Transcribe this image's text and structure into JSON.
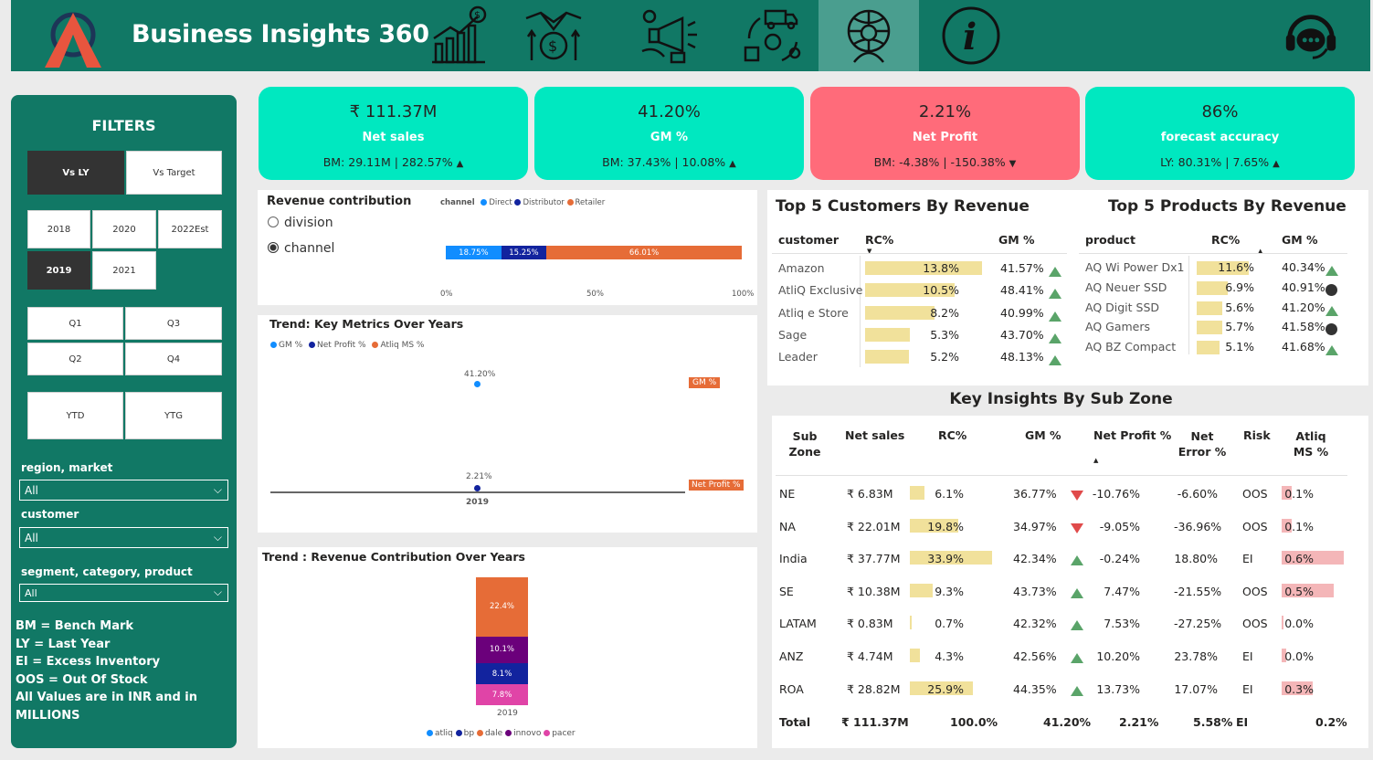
{
  "header": {
    "title": "Business Insights 360",
    "nav": [
      "finance-view-icon",
      "sales-view-icon",
      "marketing-view-icon",
      "supply-chain-view-icon",
      "executive-view-icon",
      "info-icon"
    ]
  },
  "filters": {
    "title": "FILTERS",
    "compare": [
      "Vs LY",
      "Vs Target"
    ],
    "years": [
      "2018",
      "2020",
      "2022Est",
      "2019",
      "2021"
    ],
    "quarters": [
      "Q1",
      "Q3",
      "Q2",
      "Q4"
    ],
    "ytd": [
      "YTD",
      "YTG"
    ],
    "region_label": "region, market",
    "region_value": "All",
    "customer_label": "customer",
    "customer_value": "All",
    "segment_label": "segment, category, product",
    "segment_value": "All",
    "notes": [
      "BM = Bench Mark",
      "LY = Last Year",
      "EI = Excess Inventory",
      "OOS = Out Of Stock",
      "All Values are in INR and in",
      "MILLIONS"
    ]
  },
  "kpis": [
    {
      "value": "₹ 111.37M",
      "label": "Net sales",
      "bm": "BM: 29.11M | 282.57%",
      "dir": "▲"
    },
    {
      "value": "41.20%",
      "label": "GM %",
      "bm": "BM: 37.43% | 10.08%",
      "dir": "▲"
    },
    {
      "value": "2.21%",
      "label": "Net Profit",
      "bm": "BM: -4.38% | -150.38%",
      "dir": "▼"
    },
    {
      "value": "86%",
      "label": "forecast accuracy",
      "bm": "LY: 80.31% | 7.65%",
      "dir": "▲"
    }
  ],
  "revenue_contribution": {
    "title": "Revenue contribution",
    "options": [
      "division",
      "channel"
    ],
    "selected": "channel",
    "legend_title": "channel",
    "legend": [
      "Direct",
      "Distributor",
      "Retailer"
    ],
    "colors": [
      "#118dff",
      "#12239e",
      "#e66c37"
    ],
    "values": [
      18.75,
      15.25,
      66.01
    ],
    "value_labels": [
      "18.75%",
      "15.25%",
      "66.01%"
    ],
    "axis": [
      "0%",
      "50%",
      "100%"
    ]
  },
  "trend_metrics": {
    "title": "Trend: Key Metrics Over Years",
    "legend": [
      "GM %",
      "Net Profit %",
      "Atliq MS %"
    ],
    "colors": [
      "#118dff",
      "#12239e",
      "#e66c37"
    ],
    "year": "2019",
    "gm_label": "41.20%",
    "np_label": "2.21%",
    "tag_gm": "GM %",
    "tag_np": "Net Profit %"
  },
  "trend_revenue": {
    "title": "Trend : Revenue Contribution Over Years",
    "year": "2019",
    "legend": [
      "atliq",
      "bp",
      "dale",
      "innovo",
      "pacer"
    ],
    "colors": [
      "#118dff",
      "#12239e",
      "#e66c37",
      "#6b007b",
      "#e044a7"
    ],
    "segments": [
      {
        "label": "22.4%",
        "value": 22.4,
        "color": "#e66c37"
      },
      {
        "label": "10.1%",
        "value": 10.1,
        "color": "#6b007b"
      },
      {
        "label": "8.1%",
        "value": 8.1,
        "color": "#12239e"
      },
      {
        "label": "7.8%",
        "value": 7.8,
        "color": "#e044a7"
      }
    ]
  },
  "top_customers": {
    "title": "Top 5 Customers By Revenue",
    "headers": [
      "customer",
      "RC%",
      "GM %"
    ],
    "rows": [
      {
        "name": "Amazon",
        "rc": "13.8%",
        "rc_val": 13.8,
        "gm": "41.57%",
        "icon": "up"
      },
      {
        "name": "AtliQ Exclusive",
        "rc": "10.5%",
        "rc_val": 10.5,
        "gm": "48.41%",
        "icon": "up"
      },
      {
        "name": "Atliq e Store",
        "rc": "8.2%",
        "rc_val": 8.2,
        "gm": "40.99%",
        "icon": "up"
      },
      {
        "name": "Sage",
        "rc": "5.3%",
        "rc_val": 5.3,
        "gm": "43.70%",
        "icon": "up"
      },
      {
        "name": "Leader",
        "rc": "5.2%",
        "rc_val": 5.2,
        "gm": "48.13%",
        "icon": "up"
      }
    ]
  },
  "top_products": {
    "title": "Top 5 Products By Revenue",
    "headers": [
      "product",
      "RC%",
      "GM %"
    ],
    "rows": [
      {
        "name": "AQ Wi Power Dx1",
        "rc": "11.6%",
        "rc_val": 11.6,
        "gm": "40.34%",
        "icon": "up"
      },
      {
        "name": "AQ Neuer SSD",
        "rc": "6.9%",
        "rc_val": 6.9,
        "gm": "40.91%",
        "icon": "circle"
      },
      {
        "name": "AQ Digit SSD",
        "rc": "5.6%",
        "rc_val": 5.6,
        "gm": "41.20%",
        "icon": "up"
      },
      {
        "name": "AQ Gamers",
        "rc": "5.7%",
        "rc_val": 5.7,
        "gm": "41.58%",
        "icon": "circle"
      },
      {
        "name": "AQ BZ Compact",
        "rc": "5.1%",
        "rc_val": 5.1,
        "gm": "41.68%",
        "icon": "up"
      }
    ]
  },
  "subzone": {
    "title": "Key Insights By Sub Zone",
    "headers": [
      "Sub Zone",
      "Net sales",
      "RC%",
      "GM %",
      "Net Profit %",
      "Net Error %",
      "Risk",
      "Atliq MS %"
    ],
    "rows": [
      {
        "zone": "NE",
        "sales": "₹ 6.83M",
        "rc": "6.1%",
        "rc_val": 6.1,
        "gm": "36.77%",
        "icon": "dn",
        "np": "-10.76%",
        "ne": "-6.60%",
        "risk": "OOS",
        "ms": "0.1%",
        "ms_val": 0.1
      },
      {
        "zone": "NA",
        "sales": "₹ 22.01M",
        "rc": "19.8%",
        "rc_val": 19.8,
        "gm": "34.97%",
        "icon": "dn",
        "np": "-9.05%",
        "ne": "-36.96%",
        "risk": "OOS",
        "ms": "0.1%",
        "ms_val": 0.1
      },
      {
        "zone": "India",
        "sales": "₹ 37.77M",
        "rc": "33.9%",
        "rc_val": 33.9,
        "gm": "42.34%",
        "icon": "up",
        "np": "-0.24%",
        "ne": "18.80%",
        "risk": "EI",
        "ms": "0.6%",
        "ms_val": 0.6
      },
      {
        "zone": "SE",
        "sales": "₹ 10.38M",
        "rc": "9.3%",
        "rc_val": 9.3,
        "gm": "43.73%",
        "icon": "up",
        "np": "7.47%",
        "ne": "-21.55%",
        "risk": "OOS",
        "ms": "0.5%",
        "ms_val": 0.5
      },
      {
        "zone": "LATAM",
        "sales": "₹ 0.83M",
        "rc": "0.7%",
        "rc_val": 0.7,
        "gm": "42.32%",
        "icon": "up",
        "np": "7.53%",
        "ne": "-27.25%",
        "risk": "OOS",
        "ms": "0.0%",
        "ms_val": 0.02
      },
      {
        "zone": "ANZ",
        "sales": "₹ 4.74M",
        "rc": "4.3%",
        "rc_val": 4.3,
        "gm": "42.56%",
        "icon": "up",
        "np": "10.20%",
        "ne": "23.78%",
        "risk": "EI",
        "ms": "0.0%",
        "ms_val": 0.04
      },
      {
        "zone": "ROA",
        "sales": "₹ 28.82M",
        "rc": "25.9%",
        "rc_val": 25.9,
        "gm": "44.35%",
        "icon": "up",
        "np": "13.73%",
        "ne": "17.07%",
        "risk": "EI",
        "ms": "0.3%",
        "ms_val": 0.3
      }
    ],
    "total": {
      "label": "Total",
      "sales": "₹ 111.37M",
      "rc": "100.0%",
      "gm": "41.20%",
      "np": "2.21%",
      "ne": "5.58%",
      "risk": "EI",
      "ms": "0.2%"
    }
  }
}
